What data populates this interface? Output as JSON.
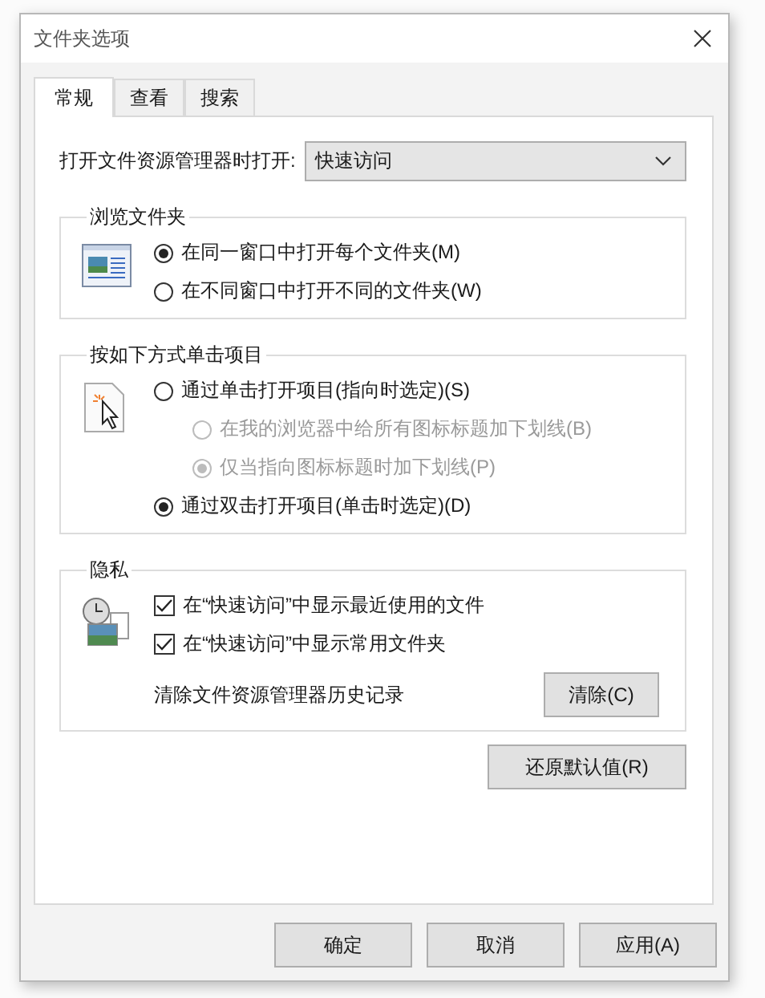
{
  "window": {
    "title": "文件夹选项"
  },
  "tabs": [
    {
      "label": "常规",
      "selected": true
    },
    {
      "label": "查看",
      "selected": false
    },
    {
      "label": "搜索",
      "selected": false
    }
  ],
  "open_with": {
    "label": "打开文件资源管理器时打开:",
    "value": "快速访问"
  },
  "groups": [
    {
      "title": "浏览文件夹",
      "items": [
        {
          "kind": "radio",
          "label": "在同一窗口中打开每个文件夹(M)",
          "selected": true,
          "disabled": false
        },
        {
          "kind": "radio",
          "label": "在不同窗口中打开不同的文件夹(W)",
          "selected": false,
          "disabled": false
        }
      ]
    },
    {
      "title": "按如下方式单击项目",
      "items": [
        {
          "kind": "radio",
          "label": "通过单击打开项目(指向时选定)(S)",
          "selected": false,
          "disabled": false,
          "children": [
            {
              "label": "在我的浏览器中给所有图标标题加下划线(B)",
              "selected": false,
              "disabled": true
            },
            {
              "label": "仅当指向图标标题时加下划线(P)",
              "selected": true,
              "disabled": true
            }
          ]
        },
        {
          "kind": "radio",
          "label": "通过双击打开项目(单击时选定)(D)",
          "selected": true,
          "disabled": false
        }
      ]
    },
    {
      "title": "隐私",
      "items": [
        {
          "kind": "checkbox",
          "label": "在“快速访问”中显示最近使用的文件",
          "checked": true
        },
        {
          "kind": "checkbox",
          "label": "在“快速访问”中显示常用文件夹",
          "checked": true
        },
        {
          "kind": "action",
          "label": "清除文件资源管理器历史记录",
          "button": "清除(C)"
        }
      ]
    }
  ],
  "restore_button": "还原默认值(R)",
  "buttons": [
    "确定",
    "取消",
    "应用(A)"
  ]
}
